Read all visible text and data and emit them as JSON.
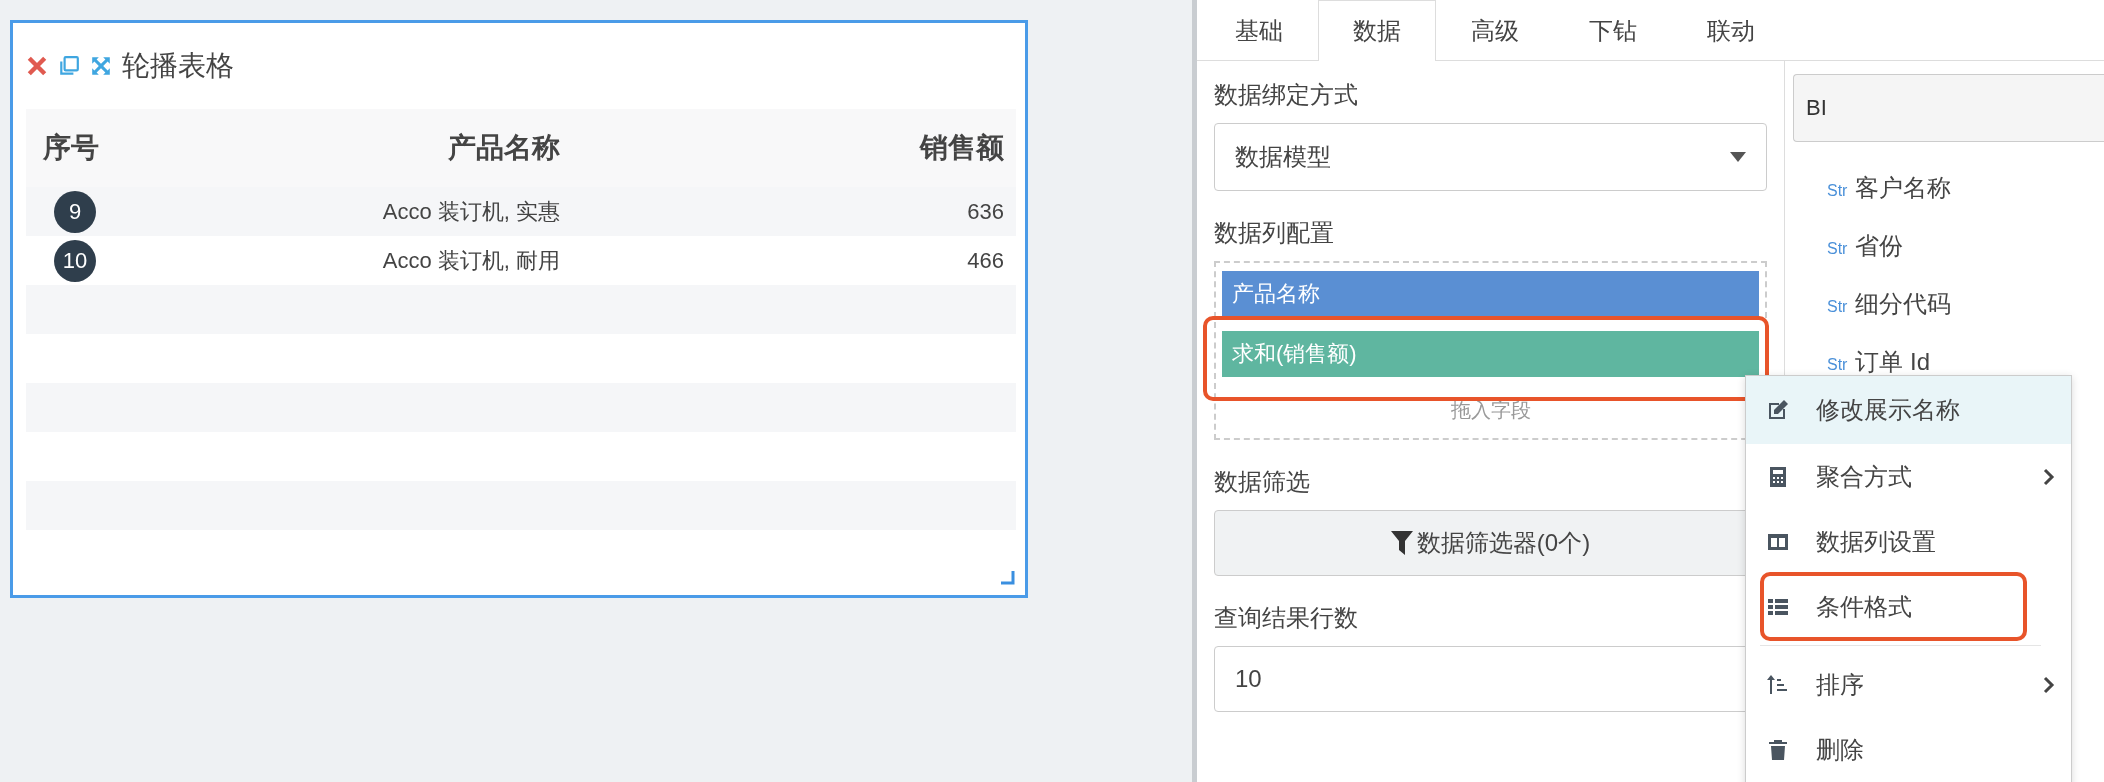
{
  "widget": {
    "title": "轮播表格",
    "columns": [
      "序号",
      "产品名称",
      "销售额"
    ],
    "rows": [
      {
        "index": "9",
        "name": "Acco 装订机, 实惠",
        "amount": "636"
      },
      {
        "index": "10",
        "name": "Acco 装订机, 耐用",
        "amount": "466"
      }
    ]
  },
  "tabs": [
    {
      "label": "基础",
      "selected": false
    },
    {
      "label": "数据",
      "selected": true
    },
    {
      "label": "高级",
      "selected": false
    },
    {
      "label": "下钻",
      "selected": false
    },
    {
      "label": "联动",
      "selected": false
    }
  ],
  "binding": {
    "label": "数据绑定方式",
    "value": "数据模型"
  },
  "column_config": {
    "label": "数据列配置",
    "items": [
      {
        "label": "产品名称",
        "kind": "dimension",
        "highlighted": false
      },
      {
        "label": "求和(销售额)",
        "kind": "measure",
        "highlighted": true
      }
    ],
    "drop_hint": "拖入字段"
  },
  "filter": {
    "label": "数据筛选",
    "button": "数据筛选器(0个)"
  },
  "row_limit": {
    "label": "查询结果行数",
    "value": "10"
  },
  "fields": {
    "search": "BI",
    "items": [
      {
        "type": "Str",
        "name": "客户名称"
      },
      {
        "type": "Str",
        "name": "省份"
      },
      {
        "type": "Str",
        "name": "细分代码"
      },
      {
        "type": "Str",
        "name": "订单 Id"
      }
    ]
  },
  "context_menu": [
    {
      "kind": "rename",
      "label": "修改展示名称",
      "hovered": true,
      "submenu": false,
      "highlighted": false,
      "divider_before": false
    },
    {
      "kind": "aggregate",
      "label": "聚合方式",
      "hovered": false,
      "submenu": true,
      "highlighted": false,
      "divider_before": false
    },
    {
      "kind": "columns",
      "label": "数据列设置",
      "hovered": false,
      "submenu": false,
      "highlighted": false,
      "divider_before": false
    },
    {
      "kind": "format",
      "label": "条件格式",
      "hovered": false,
      "submenu": false,
      "highlighted": true,
      "divider_before": false
    },
    {
      "kind": "sort",
      "label": "排序",
      "hovered": false,
      "submenu": true,
      "highlighted": false,
      "divider_before": true
    },
    {
      "kind": "delete",
      "label": "删除",
      "hovered": false,
      "submenu": false,
      "highlighted": false,
      "divider_before": false
    }
  ]
}
